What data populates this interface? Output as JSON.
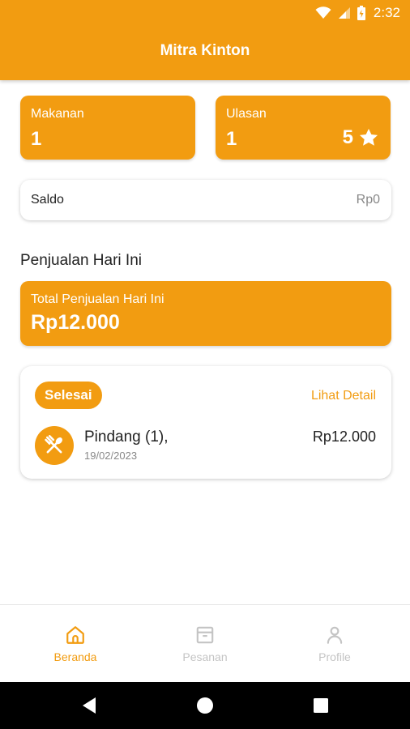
{
  "status_bar": {
    "time": "2:32"
  },
  "app": {
    "title": "Mitra Kinton"
  },
  "stats": {
    "makanan": {
      "label": "Makanan",
      "value": "1"
    },
    "ulasan": {
      "label": "Ulasan",
      "value": "1",
      "rating": "5",
      "rating_icon": "star-icon"
    }
  },
  "saldo": {
    "label": "Saldo",
    "value": "Rp0"
  },
  "today": {
    "section_title": "Penjualan Hari Ini",
    "total_label": "Total Penjualan Hari Ini",
    "total_value": "Rp12.000"
  },
  "order": {
    "status": "Selesai",
    "detail_link": "Lihat Detail",
    "item_name": "Pindang (1),",
    "date": "19/02/2023",
    "price": "Rp12.000",
    "icon": "fork-spoon-icon"
  },
  "bottom_nav": [
    {
      "label": "Beranda",
      "icon": "home-icon",
      "active": true
    },
    {
      "label": "Pesanan",
      "icon": "archive-icon",
      "active": false
    },
    {
      "label": "Profile",
      "icon": "person-icon",
      "active": false
    }
  ],
  "colors": {
    "accent": "#F29C11",
    "inactive": "#c4c4c4",
    "system_nav": "#000000"
  }
}
